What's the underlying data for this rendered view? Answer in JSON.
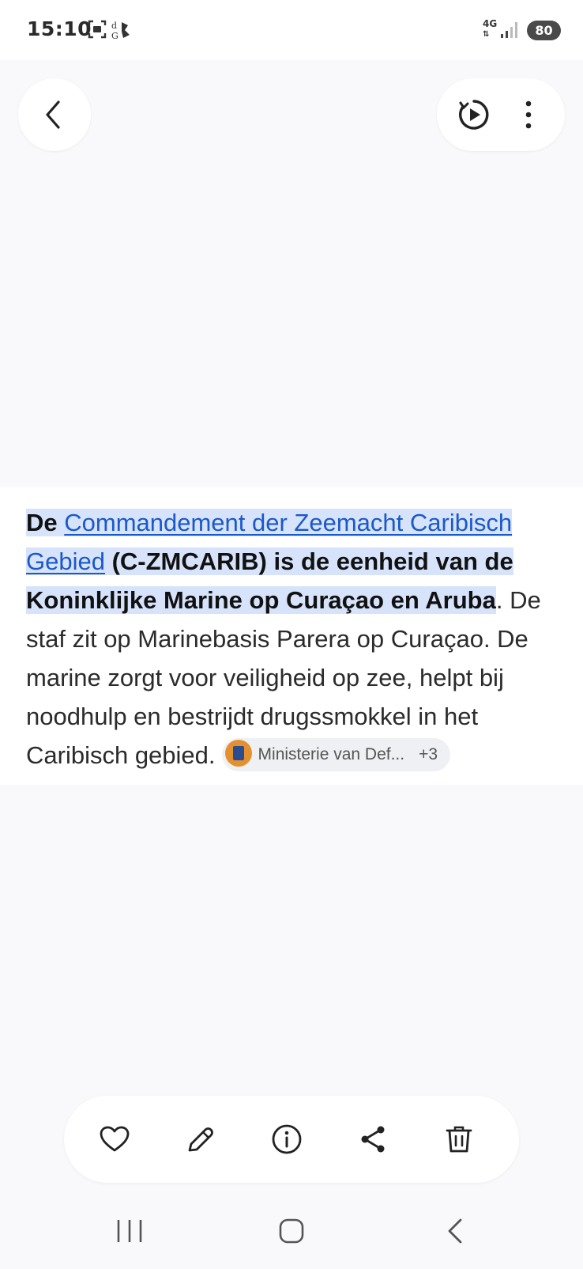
{
  "status_bar": {
    "time": "15:10",
    "network": "4G",
    "battery": "80",
    "icons": [
      "screenshot-icon",
      "app-notification-icon",
      "signal-icon"
    ]
  },
  "header": {
    "back_icon": "chevron-left-icon",
    "actions": [
      "motion-photo-play-icon",
      "more-vertical-icon"
    ]
  },
  "paragraph": {
    "part1": "De ",
    "link_text": "Commandement der Zeemacht Caribisch Gebied",
    "part2": " (C-ZMCARIB) is de eenheid van de Koninklijke Marine op Curaçao en Aruba",
    "part3": ". De staf zit op Marinebasis Parera op Curaçao. De marine zorgt voor veiligheid op zee, helpt bij noodhulp en bestrijdt drugssmokkel in het Caribisch gebied.",
    "source_chip": {
      "label": "Ministerie van Def...",
      "count": "+3"
    }
  },
  "toolbar": {
    "items": [
      "heart-icon",
      "edit-pencil-icon",
      "info-icon",
      "share-icon",
      "trash-icon"
    ]
  },
  "nav_bar": {
    "items": [
      "recent-apps-icon",
      "home-icon",
      "back-icon"
    ]
  },
  "colors": {
    "highlight": "#d7e3fb",
    "link": "#1a59c9",
    "background": "#f9f9fb"
  }
}
